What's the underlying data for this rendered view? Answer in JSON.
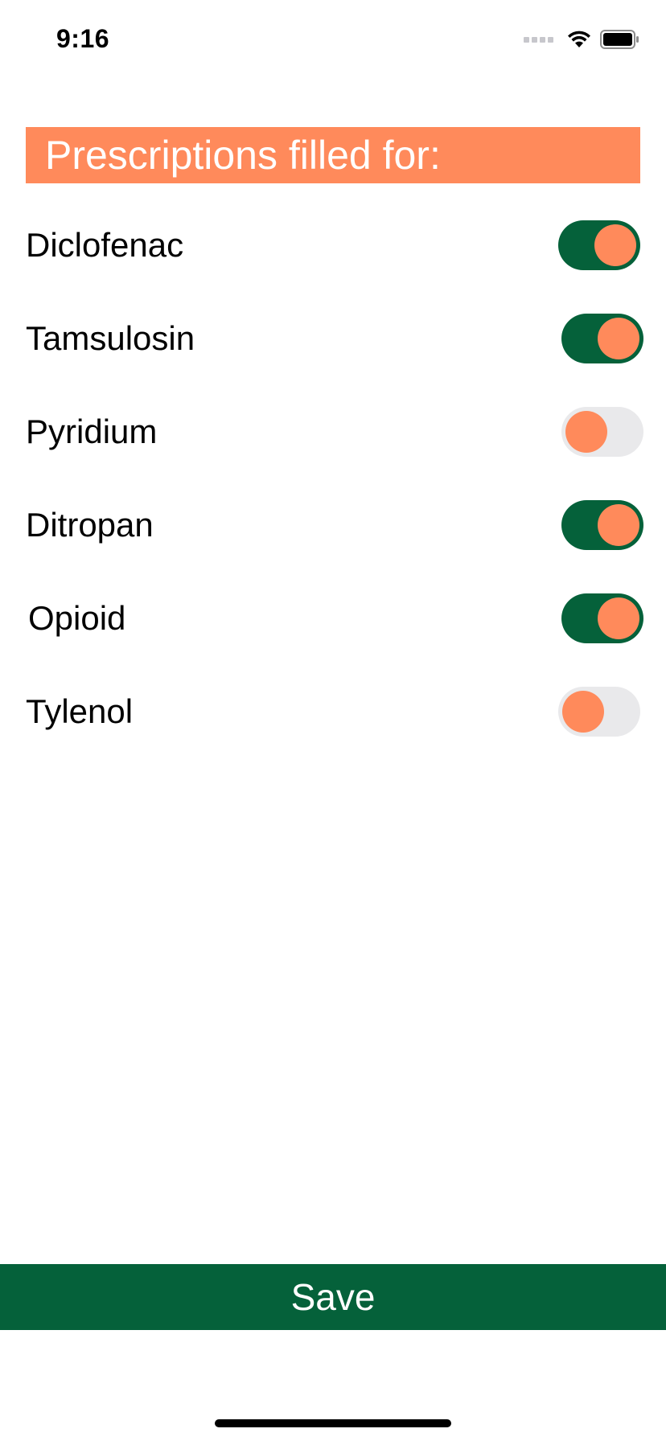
{
  "status_bar": {
    "time": "9:16",
    "icons": [
      "signal-icon",
      "wifi-icon",
      "battery-icon"
    ]
  },
  "header": {
    "title": "Prescriptions filled for:"
  },
  "prescriptions": [
    {
      "label": "Diclofenac",
      "on": true
    },
    {
      "label": "Tamsulosin",
      "on": true
    },
    {
      "label": "Pyridium",
      "on": false
    },
    {
      "label": "Ditropan",
      "on": true
    },
    {
      "label": "Opioid",
      "on": true
    },
    {
      "label": "Tylenol",
      "on": false
    }
  ],
  "save_button": {
    "label": "Save"
  },
  "colors": {
    "accent": "#ff8a5b",
    "primary": "#05613a",
    "toggle_off": "#e9e9eb"
  }
}
